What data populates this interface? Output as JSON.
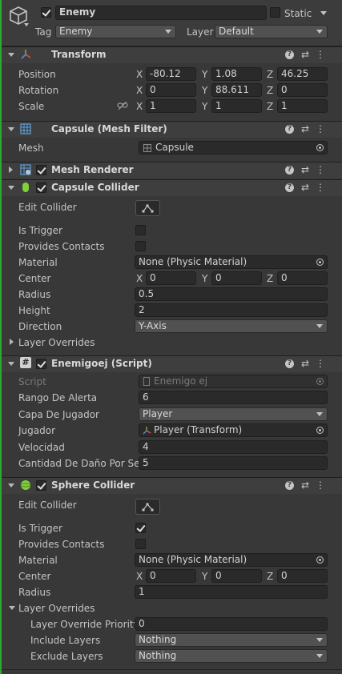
{
  "header": {
    "object_name": "Enemy",
    "static_label": "Static",
    "tag_label": "Tag",
    "tag_value": "Enemy",
    "layer_label": "Layer",
    "layer_value": "Default"
  },
  "transform": {
    "title": "Transform",
    "position_label": "Position",
    "rotation_label": "Rotation",
    "scale_label": "Scale",
    "x": "X",
    "y": "Y",
    "z": "Z",
    "position": [
      "-80.12",
      "1.08",
      "46.25"
    ],
    "rotation": [
      "0",
      "88.611",
      "0"
    ],
    "scale": [
      "1",
      "1",
      "1"
    ]
  },
  "mesh_filter": {
    "title": "Capsule (Mesh Filter)",
    "mesh_label": "Mesh",
    "mesh_value": "Capsule"
  },
  "mesh_renderer": {
    "title": "Mesh Renderer"
  },
  "capsule_collider": {
    "title": "Capsule Collider",
    "edit_collider": "Edit Collider",
    "is_trigger": "Is Trigger",
    "provides_contacts": "Provides Contacts",
    "material_label": "Material",
    "material_value": "None (Physic Material)",
    "center_label": "Center",
    "center": [
      "0",
      "0",
      "0"
    ],
    "radius_label": "Radius",
    "radius_value": "0.5",
    "height_label": "Height",
    "height_value": "2",
    "direction_label": "Direction",
    "direction_value": "Y-Axis",
    "layer_overrides": "Layer Overrides"
  },
  "script": {
    "title": "Enemigoej (Script)",
    "script_label": "Script",
    "script_value": "Enemigo ej",
    "rango_label": "Rango De Alerta",
    "rango_value": "6",
    "capa_label": "Capa De Jugador",
    "capa_value": "Player",
    "jugador_label": "Jugador",
    "jugador_value": "Player (Transform)",
    "velocidad_label": "Velocidad",
    "velocidad_value": "4",
    "dano_label": "Cantidad De Daño Por Seg",
    "dano_value": "5"
  },
  "sphere_collider": {
    "title": "Sphere Collider",
    "edit_collider": "Edit Collider",
    "is_trigger": "Is Trigger",
    "provides_contacts": "Provides Contacts",
    "material_label": "Material",
    "material_value": "None (Physic Material)",
    "center_label": "Center",
    "center": [
      "0",
      "0",
      "0"
    ],
    "radius_label": "Radius",
    "radius_value": "1",
    "layer_overrides": "Layer Overrides",
    "priority_label": "Layer Override Priority",
    "priority_value": "0",
    "include_label": "Include Layers",
    "include_value": "Nothing",
    "exclude_label": "Exclude Layers",
    "exclude_value": "Nothing"
  },
  "icons": {
    "question": "?",
    "presets": "⇄",
    "menu": "⋮"
  },
  "colors": {
    "background": "#383838",
    "header_background": "#3e3e3e",
    "field_background": "#2a2a2a",
    "dropdown_background": "#515151",
    "text": "#c4c4c4",
    "selection_edge": "#2fa82f"
  }
}
